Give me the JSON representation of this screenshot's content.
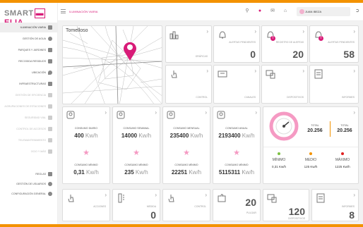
{
  "app": {
    "logo_text_a": "SMART",
    "logo_text_b": "ELIA",
    "module_title": "Iluminación viaria"
  },
  "header": {
    "user_name": "Juan Ibeza"
  },
  "sidebar": {
    "items": [
      {
        "label": "Iluminación viaria"
      },
      {
        "label": "Gestión de agua"
      },
      {
        "label": "Parques y jardines"
      },
      {
        "label": "Recogida residuos"
      },
      {
        "label": "Ubicación"
      },
      {
        "label": "Infraestructuras"
      },
      {
        "label": "Gestión de eficiencia"
      },
      {
        "label": "Agrupaciones de estaciones"
      },
      {
        "label": "Seguridad vial"
      },
      {
        "label": "Control de accesos"
      },
      {
        "label": "Telemantenimiento"
      },
      {
        "label": "Ocio y más"
      },
      {
        "label": "Reglas"
      },
      {
        "label": "Gestión de usuarios"
      },
      {
        "label": "Configuración general"
      }
    ]
  },
  "map": {
    "title": "Tomelloso"
  },
  "top_cards": [
    {
      "label": "Gráficas",
      "value": ""
    },
    {
      "label": "Alertas pendientes",
      "value": "0"
    },
    {
      "label": "Registro de alertas",
      "value": "20"
    },
    {
      "label": "Alertas pendientes",
      "value": "58"
    },
    {
      "label": "Control",
      "value": ""
    },
    {
      "label": "Canales",
      "value": ""
    },
    {
      "label": "Dispositivos",
      "value": ""
    },
    {
      "label": "Informes",
      "value": ""
    }
  ],
  "consumption": [
    {
      "title": "Consumo diario",
      "value": "400",
      "unit": "Kw/h",
      "min_title": "Consumo mínimo",
      "min_value": "0,31",
      "min_unit": "Kw/h"
    },
    {
      "title": "Consumo semanal",
      "value": "14000",
      "unit": "Kw/h",
      "min_title": "Consumo mínimo",
      "min_value": "235",
      "min_unit": "Kw/h"
    },
    {
      "title": "Consumo mensual",
      "value": "235400",
      "unit": "Kw/h",
      "min_title": "Consumo mínimo",
      "min_value": "22251",
      "min_unit": "Kw/h"
    },
    {
      "title": "Consumo anual",
      "value": "2193400",
      "unit": "Kw/h",
      "min_title": "Consumo mínimo",
      "min_value": "5115311",
      "min_unit": "Kw/h"
    }
  ],
  "totals": {
    "total_a_label": "Total",
    "total_a_value": "20.256",
    "total_b_label": "Total",
    "total_b_value": "20.256",
    "stats": [
      {
        "label": "Mínimo",
        "value": "0,31 Kw/h",
        "color": "#7cc142"
      },
      {
        "label": "Medio",
        "value": "125 Kw/h",
        "color": "#f39200"
      },
      {
        "label": "Máximo",
        "value": "1225 Kw/h",
        "color": "#e02020"
      }
    ]
  },
  "bottom_cards": [
    {
      "label": "Acciones",
      "value": ""
    },
    {
      "label": "Medida",
      "value": "0"
    },
    {
      "label": "Control",
      "value": ""
    },
    {
      "label": "Pulgar",
      "value": "20"
    },
    {
      "label": "Dispositivos",
      "value": "120"
    },
    {
      "label": "Informes",
      "value": "8"
    }
  ],
  "colors": {
    "accent": "#d81b78",
    "topbar": "#f39200",
    "star": "#f59ac3"
  }
}
